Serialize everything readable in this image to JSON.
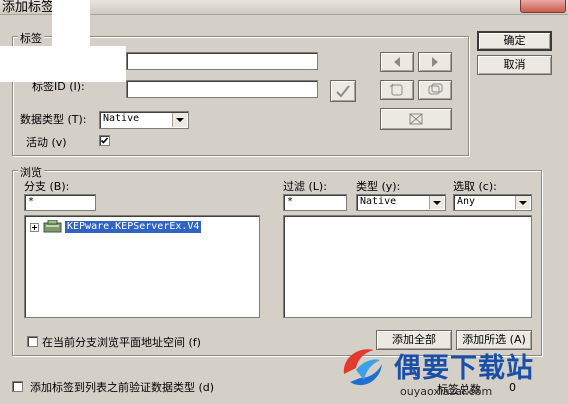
{
  "window": {
    "title": "添加标签"
  },
  "buttons": {
    "ok": "确定",
    "cancel": "取消"
  },
  "tag_group": {
    "label": "标签",
    "tag_id_label": "标签ID (I):",
    "datatype_label": "数据类型 (T):",
    "datatype_value": "Native",
    "active_label": "活动 (v)",
    "active_checked": true
  },
  "browse": {
    "label": "浏览",
    "branch_label": "分支 (B):",
    "branch_value": "*",
    "filter_label": "过滤 (L):",
    "filter_value": "*",
    "type_label": "类型 (y):",
    "type_value": "Native",
    "select_label": "选取 (c):",
    "select_value": "Any",
    "tree_item": "KEPware.KEPServerEx.V4",
    "flat_checkbox_label": "在当前分支浏览平面地址空间 (f)",
    "add_all": "添加全部",
    "add_selected": "添加所选 (A)"
  },
  "footer": {
    "validate_label": "添加标签到列表之前验证数据类型 (d)",
    "tag_count_label": "标签总数",
    "tag_count": "0"
  },
  "watermark": {
    "name": "偶要下载站",
    "url": "ouyaoxiazai.com"
  }
}
